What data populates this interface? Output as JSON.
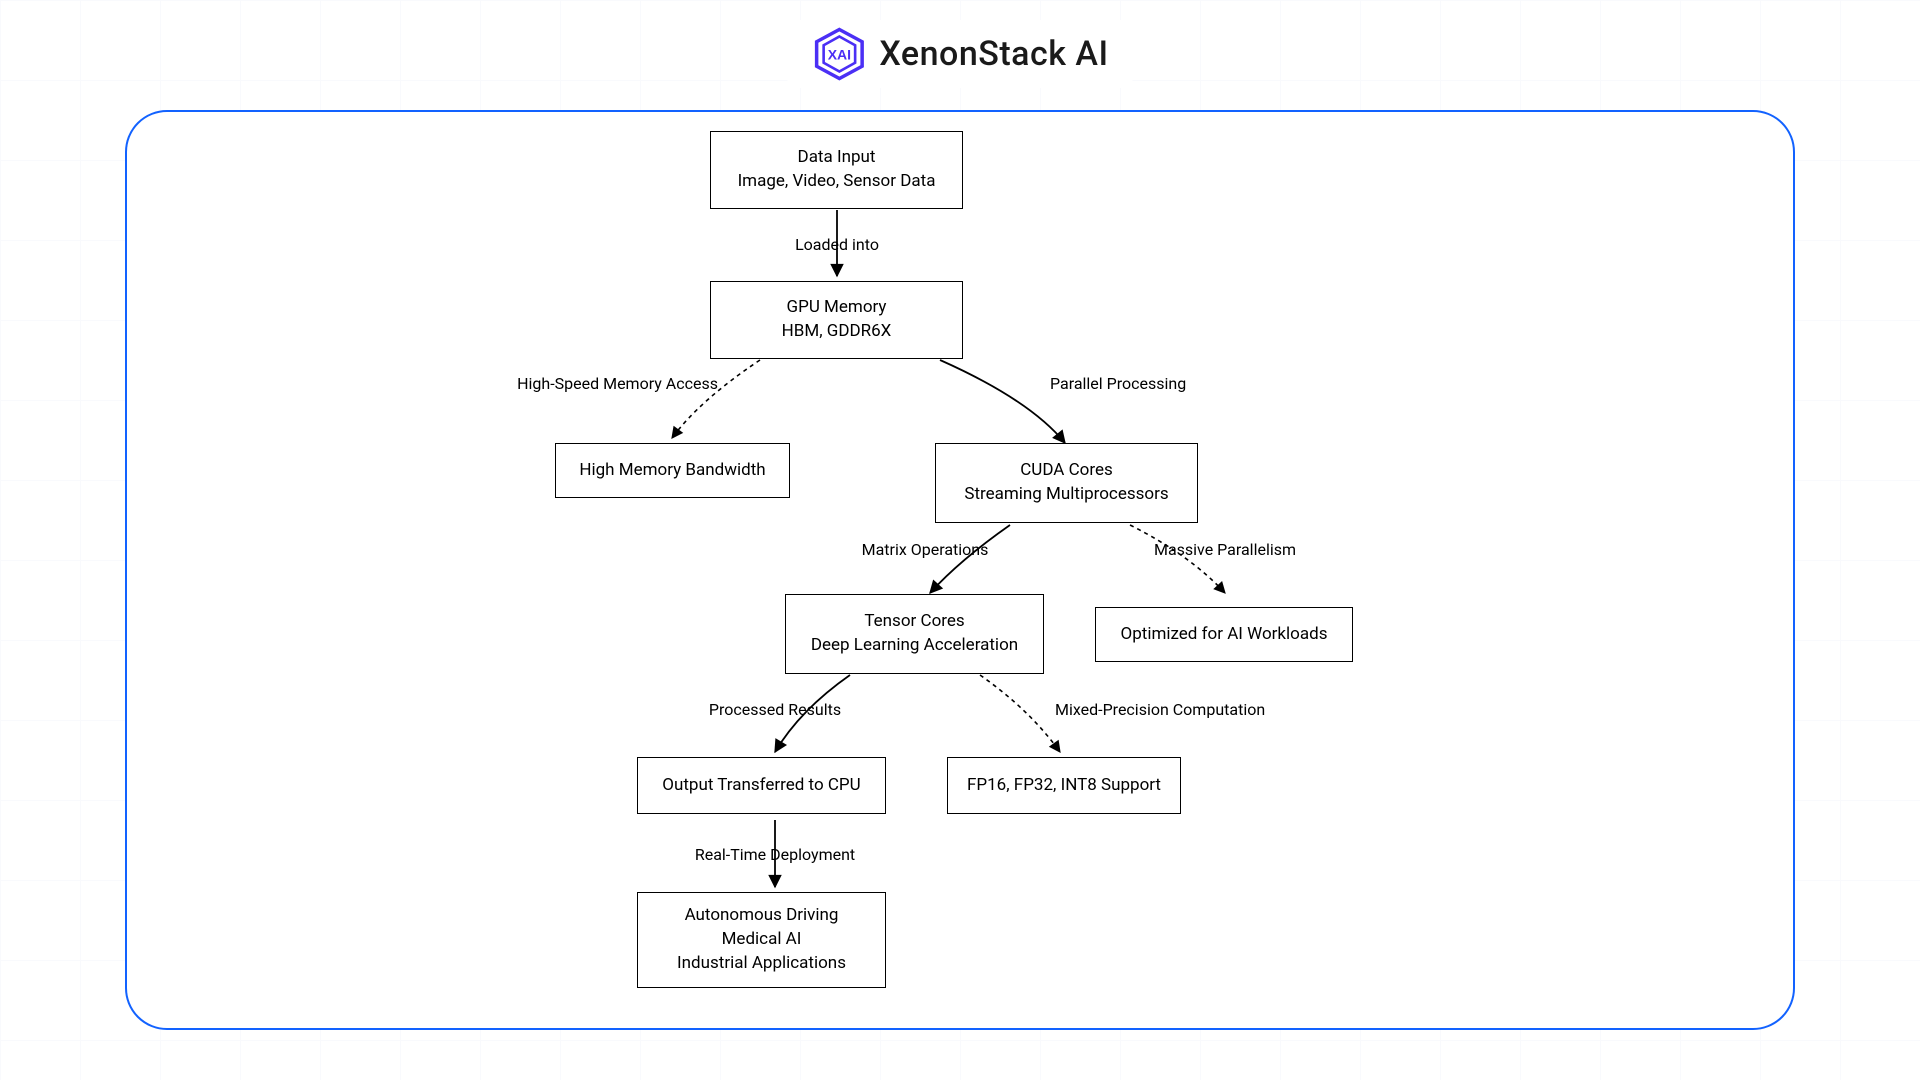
{
  "brand": {
    "name": "XenonStack AI"
  },
  "diagram": {
    "nodes": {
      "data_input": {
        "l1": "Data Input",
        "l2": "Image, Video, Sensor Data"
      },
      "gpu_mem": {
        "l1": "GPU Memory",
        "l2": "HBM, GDDR6X"
      },
      "hmb": {
        "l1": "High Memory Bandwidth"
      },
      "cuda": {
        "l1": "CUDA Cores",
        "l2": "Streaming Multiprocessors"
      },
      "tensor": {
        "l1": "Tensor Cores",
        "l2": "Deep Learning Acceleration"
      },
      "ai_opt": {
        "l1": "Optimized for AI Workloads"
      },
      "out_cpu": {
        "l1": "Output Transferred to CPU"
      },
      "fp": {
        "l1": "FP16, FP32, INT8 Support"
      },
      "apps": {
        "l1": "Autonomous Driving",
        "l2": "Medical AI",
        "l3": "Industrial Applications"
      }
    },
    "edges": {
      "e_load": "Loaded into",
      "e_hsm": "High-Speed Memory Access",
      "e_pp": "Parallel Processing",
      "e_mx": "Matrix Operations",
      "e_mp": "Massive Parallelism",
      "e_pr": "Processed Results",
      "e_mpc": "Mixed-Precision Computation",
      "e_rtd": "Real-Time Deployment"
    }
  }
}
